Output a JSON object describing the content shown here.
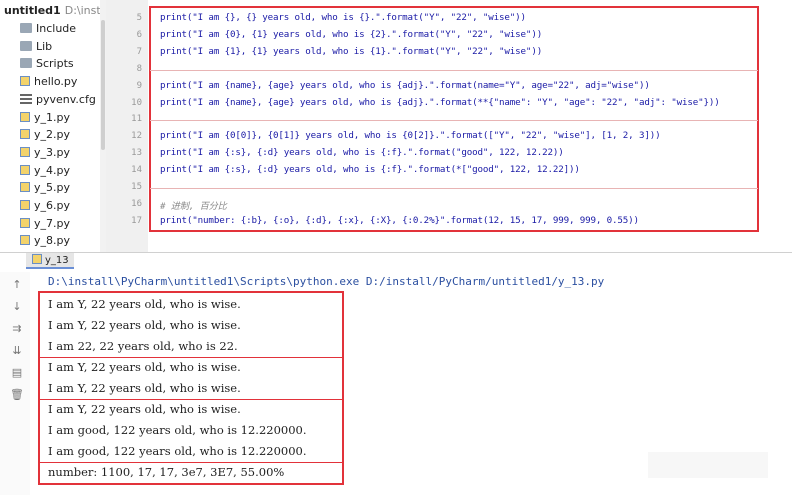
{
  "project": {
    "root_name": "untitled1",
    "root_path": "D:\\inst",
    "items": [
      {
        "name": "Include",
        "icon": "folder-icon"
      },
      {
        "name": "Lib",
        "icon": "folder-icon"
      },
      {
        "name": "Scripts",
        "icon": "folder-icon"
      },
      {
        "name": "hello.py",
        "icon": "python-file-icon"
      },
      {
        "name": "pyvenv.cfg",
        "icon": "config-file-icon"
      },
      {
        "name": "y_1.py",
        "icon": "python-file-icon"
      },
      {
        "name": "y_2.py",
        "icon": "python-file-icon"
      },
      {
        "name": "y_3.py",
        "icon": "python-file-icon"
      },
      {
        "name": "y_4.py",
        "icon": "python-file-icon"
      },
      {
        "name": "y_5.py",
        "icon": "python-file-icon"
      },
      {
        "name": "y_6.py",
        "icon": "python-file-icon"
      },
      {
        "name": "y_7.py",
        "icon": "python-file-icon"
      },
      {
        "name": "y_8.py",
        "icon": "python-file-icon"
      }
    ]
  },
  "editor": {
    "lines": [
      {
        "num": "5",
        "text": "print(\"I am {}, {} years old, who is {}.\".format(\"Y\", \"22\", \"wise\"))"
      },
      {
        "num": "6",
        "text": "print(\"I am {0}, {1} years old, who is {2}.\".format(\"Y\", \"22\", \"wise\"))"
      },
      {
        "num": "7",
        "text": "print(\"I am {1}, {1} years old, who is {1}.\".format(\"Y\", \"22\", \"wise\"))"
      },
      {
        "num": "8",
        "text": ""
      },
      {
        "num": "9",
        "text": "print(\"I am {name}, {age} years old, who is {adj}.\".format(name=\"Y\", age=\"22\", adj=\"wise\"))"
      },
      {
        "num": "10",
        "text": "print(\"I am {name}, {age} years old, who is {adj}.\".format(**{\"name\": \"Y\", \"age\": \"22\", \"adj\": \"wise\"}))"
      },
      {
        "num": "11",
        "text": ""
      },
      {
        "num": "12",
        "text": "print(\"I am {0[0]}, {0[1]} years old, who is {0[2]}.\".format([\"Y\", \"22\", \"wise\"], [1, 2, 3]))"
      },
      {
        "num": "13",
        "text": "print(\"I am {:s}, {:d} years old, who is {:f}.\".format(\"good\", 122, 12.22))"
      },
      {
        "num": "14",
        "text": "print(\"I am {:s}, {:d} years old, who is {:f}.\".format(*[\"good\", 122, 12.22]))"
      },
      {
        "num": "15",
        "text": ""
      },
      {
        "num": "16",
        "text": "# 进制, 百分比"
      },
      {
        "num": "17",
        "text": "print(\"number: {:b}, {:o}, {:d}, {:x}, {:X}, {:0.2%}\".format(12, 15, 17, 999, 999, 0.55))"
      }
    ]
  },
  "run": {
    "tab_label": "y_13",
    "command": "D:\\install\\PyCharm\\untitled1\\Scripts\\python.exe D:/install/PyCharm/untitled1/y_13.py",
    "output": [
      "I am Y, 22 years old, who is wise.",
      "I am Y, 22 years old, who is wise.",
      "I am 22, 22 years old, who is 22.",
      "I am Y, 22 years old, who is wise.",
      "I am Y, 22 years old, who is wise.",
      "I am Y, 22 years old, who is wise.",
      "I am good, 122 years old, who is 12.220000.",
      "I am good, 122 years old, who is 12.220000.",
      "number: 1100, 17, 17, 3e7, 3E7, 55.00%"
    ],
    "toolbar": [
      {
        "icon": "arrow-up-icon",
        "glyph": "↑"
      },
      {
        "icon": "arrow-down-icon",
        "glyph": "↓"
      },
      {
        "icon": "soft-wrap-icon",
        "glyph": "⇉"
      },
      {
        "icon": "scroll-to-end-icon",
        "glyph": "⇊"
      },
      {
        "icon": "print-icon",
        "glyph": "▤"
      },
      {
        "icon": "trash-icon",
        "glyph": "🗑"
      }
    ]
  },
  "colors": {
    "highlight_border": "#e2323a",
    "code_text": "#1a1aa6"
  }
}
